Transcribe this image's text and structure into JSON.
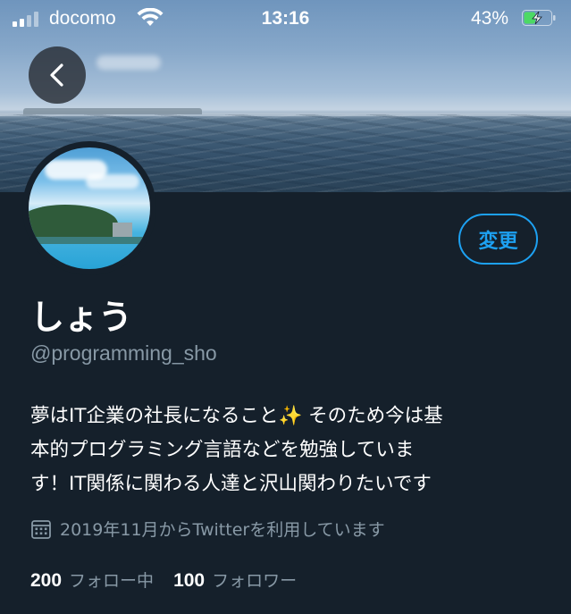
{
  "status_bar": {
    "carrier": "docomo",
    "time": "13:16",
    "battery_percent": "43%",
    "battery_level": 0.43,
    "signal_bars": 2,
    "signal_max": 4
  },
  "header": {
    "back_icon": "chevron-left-icon"
  },
  "profile": {
    "display_name": "しょう",
    "handle": "@programming_sho",
    "edit_button_label": "変更",
    "bio_part1": "夢はIT企業の社長になること",
    "bio_sparkle": "✨",
    "bio_part2": " そのため今は基\n本的プログラミング言語などを勉強していま\nす！IT関係に関わる人達と沢山関わりたいです",
    "joined_text": "2019年11月からTwitterを利用しています",
    "joined_icon": "calendar-icon",
    "following_count": "200",
    "following_label": "フォロー中",
    "followers_count": "100",
    "followers_label": "フォロワー"
  },
  "colors": {
    "background": "#15202b",
    "accent": "#1da1f2",
    "secondary_text": "#8899a6",
    "battery_green": "#4cd964"
  }
}
